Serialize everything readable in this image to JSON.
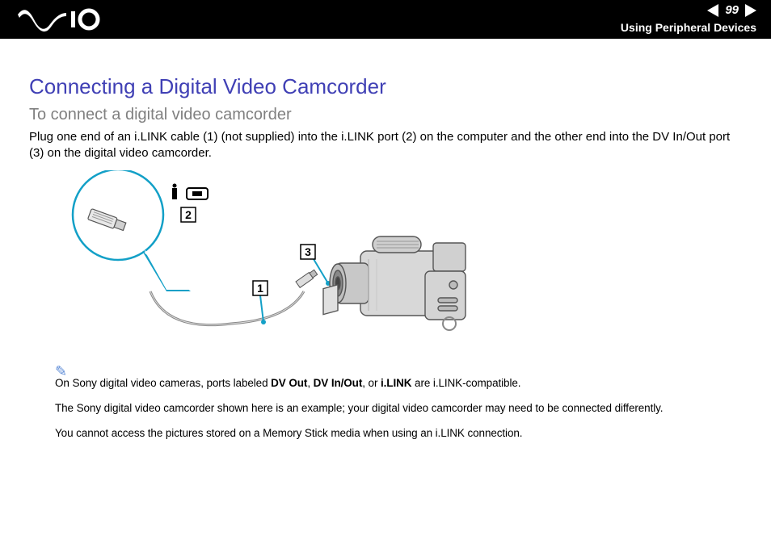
{
  "header": {
    "page_number": "99",
    "section": "Using Peripheral Devices",
    "logo_alt": "VAIO"
  },
  "title": "Connecting a Digital Video Camcorder",
  "subtitle": "To connect a digital video camcorder",
  "body_intro": "Plug one end of an i.LINK cable (1) (not supplied) into the i.LINK port (2) on the computer and the other end into the DV In/Out port (3) on the digital video camcorder.",
  "figure": {
    "callout_1": "1",
    "callout_2": "2",
    "callout_3": "3"
  },
  "notes": {
    "n1_a": "On Sony digital video cameras, ports labeled ",
    "n1_b1": "DV Out",
    "n1_c": ", ",
    "n1_b2": "DV In/Out",
    "n1_d": ", or ",
    "n1_b3": "i.LINK",
    "n1_e": " are i.LINK-compatible.",
    "n2": "The Sony digital video camcorder shown here is an example; your digital video camcorder may need to be connected differently.",
    "n3": "You cannot access the pictures stored on a Memory Stick media when using an i.LINK connection."
  }
}
